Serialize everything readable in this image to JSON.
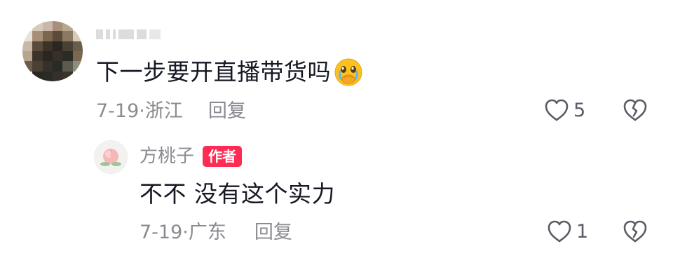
{
  "comment": {
    "text": "下一步要开直播带货吗",
    "emoji": "crying-face-emoji",
    "date": "7-19",
    "separator": "·",
    "location": "浙江",
    "reply_label": "回复",
    "like_count": "5"
  },
  "reply": {
    "author_name": "方桃子",
    "author_badge": "作者",
    "text": "不不 没有这个实力",
    "date": "7-19",
    "separator": "·",
    "location": "广东",
    "reply_label": "回复",
    "like_count": "1"
  },
  "colors": {
    "badge": "#fe2c55",
    "meta_text": "#8a8b91",
    "primary_text": "#161823"
  }
}
